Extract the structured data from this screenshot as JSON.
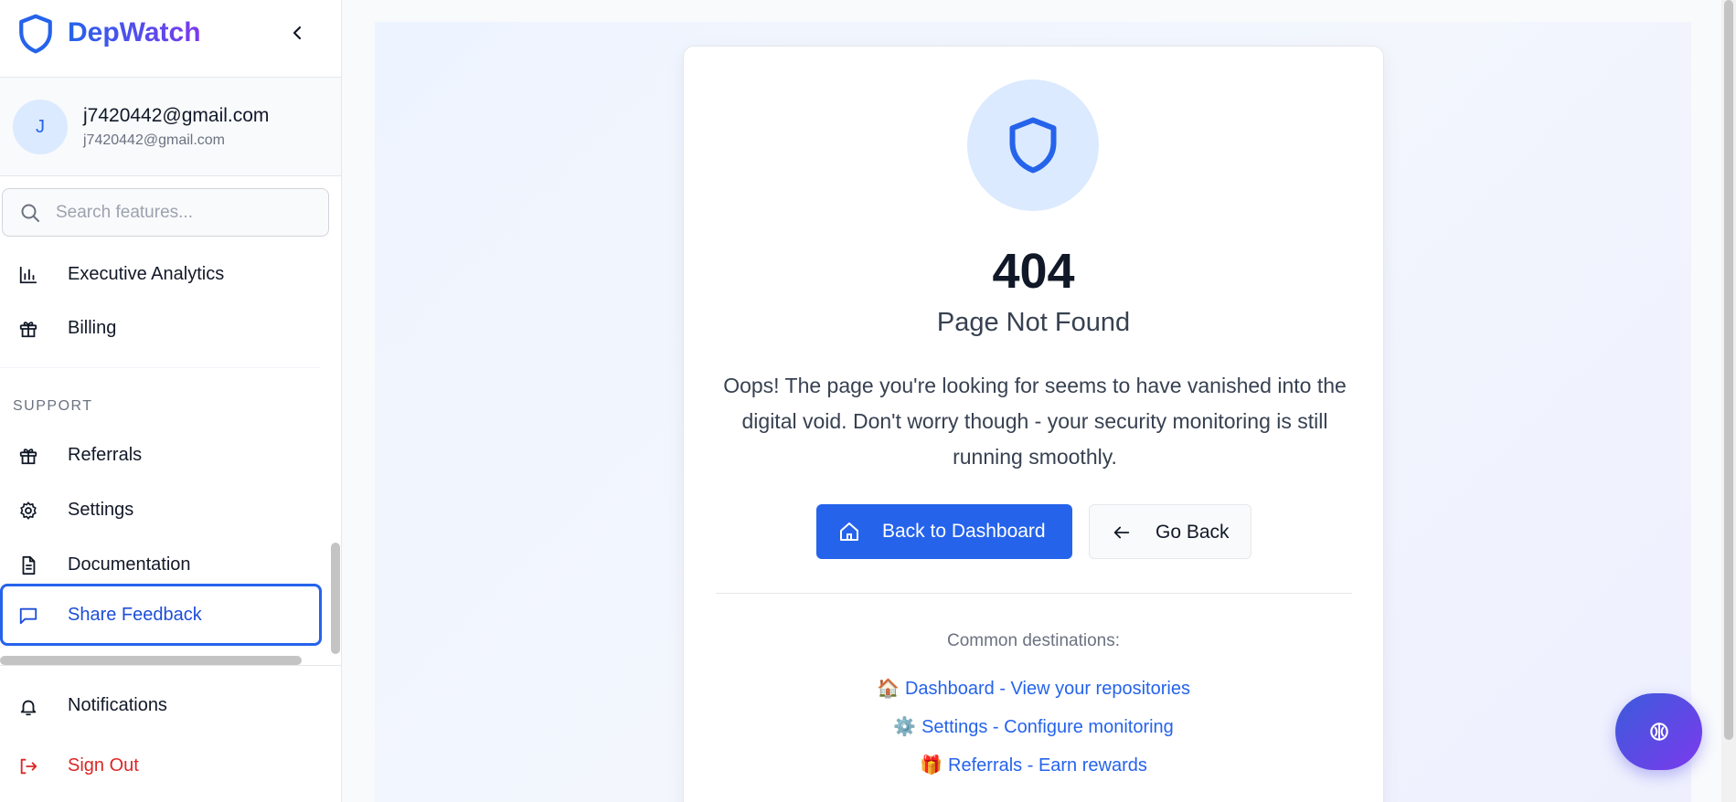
{
  "brand": {
    "name": "DepWatch",
    "logo_icon": "shield-icon",
    "collapse_icon": "chevron-left-icon"
  },
  "user": {
    "avatar_initial": "J",
    "name": "j7420442@gmail.com",
    "email": "j7420442@gmail.com"
  },
  "search": {
    "placeholder": "Search features...",
    "value": "",
    "icon": "search-icon"
  },
  "sidebar": {
    "items": [
      {
        "label": "Executive Analytics",
        "icon": "bar-chart-icon"
      },
      {
        "label": "Billing",
        "icon": "gift-icon"
      }
    ],
    "support_section": {
      "title": "SUPPORT",
      "items": [
        {
          "label": "Referrals",
          "icon": "gift-icon"
        },
        {
          "label": "Settings",
          "icon": "gear-icon"
        },
        {
          "label": "Documentation",
          "icon": "document-icon"
        },
        {
          "label": "Share Feedback",
          "icon": "message-square-icon",
          "active": true
        }
      ]
    },
    "bottom": [
      {
        "label": "Notifications",
        "icon": "bell-icon"
      },
      {
        "label": "Sign Out",
        "icon": "sign-out-icon",
        "color": "#dc2626"
      }
    ]
  },
  "error": {
    "code": "404",
    "title": "Page Not Found",
    "message": "Oops! The page you're looking for seems to have vanished into the digital void. Don't worry though - your security monitoring is still running smoothly.",
    "icon": "shield-icon"
  },
  "actions": {
    "primary": {
      "label": "Back to Dashboard",
      "icon": "home-icon"
    },
    "secondary": {
      "label": "Go Back",
      "icon": "arrow-left-icon"
    }
  },
  "destinations": {
    "title": "Common destinations:",
    "links": [
      {
        "emoji": "🏠",
        "label": "Dashboard - View your repositories"
      },
      {
        "emoji": "⚙️",
        "label": "Settings - Configure monitoring"
      },
      {
        "emoji": "🎁",
        "label": "Referrals - Earn rewards"
      }
    ]
  },
  "fab": {
    "icon": "brain-icon"
  },
  "colors": {
    "accent": "#2563eb",
    "brand_gradient_end": "#7c3aed",
    "danger": "#dc2626"
  }
}
